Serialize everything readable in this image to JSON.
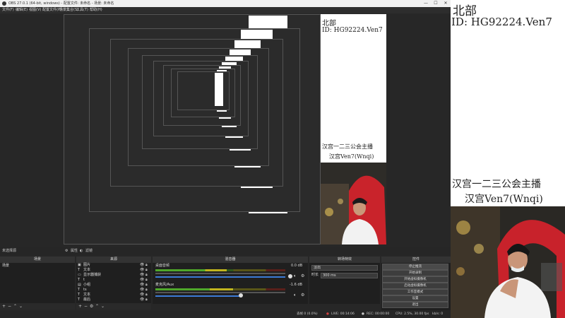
{
  "window": {
    "title": "OBS 27.0.1 (64-bit, windows) - 配置文件: 未命名 - 场景: 未命名",
    "minimize": "—",
    "maximize": "☐",
    "close": "✕"
  },
  "menu": [
    "文件(F)",
    "编辑(E)",
    "视图(V)",
    "配置文件(P)",
    "场景集合(S)",
    "工具(T)",
    "帮助(H)"
  ],
  "overlay": {
    "region": "北部",
    "id_line": "ID: HG92224.Ven7",
    "guild_line": "汉宫一二三公会主播",
    "name_line": "汉宫Ven7(Wnqi)"
  },
  "dock_bar": {
    "no_source": "未选择源",
    "properties": "属性",
    "filters": "滤镜"
  },
  "docks": {
    "scenes": {
      "header": "场景",
      "items": [
        "场景"
      ]
    },
    "sources": {
      "header": "来源",
      "items": [
        {
          "label": "图片",
          "icon": "image-icon"
        },
        {
          "label": "文本",
          "icon": "text-icon"
        },
        {
          "label": "显示器捕获",
          "icon": "monitor-icon"
        },
        {
          "label": "t",
          "icon": "text-icon"
        },
        {
          "label": "小组",
          "icon": "group-icon"
        },
        {
          "label": "ts",
          "icon": "text-icon"
        },
        {
          "label": "文本",
          "icon": "text-icon"
        },
        {
          "label": "最后",
          "icon": "text-icon"
        }
      ]
    },
    "mixer": {
      "header": "混音器",
      "channels": [
        {
          "name": "桌面音频",
          "db": "0.0 dB",
          "level": 0.55
        },
        {
          "name": "麦克风/Aux",
          "db": "-1.6 dB",
          "level": 0.6
        }
      ]
    },
    "transitions": {
      "header": "转场特效",
      "mode": "淡出",
      "duration_label": "时长",
      "duration_value": "300 ms"
    },
    "controls": {
      "header": "控件",
      "buttons": [
        "停止推流",
        "开始录制",
        "开始虚拟摄像机",
        "启动虚拟摄像机",
        "工作室模式",
        "设置",
        "退出"
      ]
    }
  },
  "status": {
    "dropped": "丢帧 0 (0.0%)",
    "live": "LIVE: 00:14:06",
    "rec": "REC: 00:00:00",
    "cpu": "CPU: 2.5%, 30.00 fps",
    "kbps": "kb/s: 0"
  },
  "colors": {
    "window_bg": "#272727",
    "meter_green": "#4fa82a",
    "meter_yellow": "#c2b51e",
    "meter_red": "#b5362b",
    "slider_blue": "#3c7bd6"
  }
}
